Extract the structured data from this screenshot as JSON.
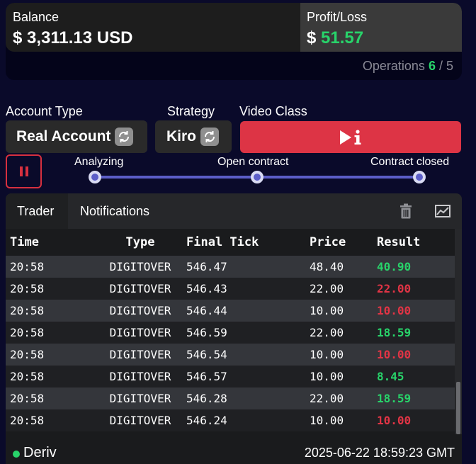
{
  "header": {
    "balance_label": "Balance",
    "balance_value": "$ 3,311.13 USD",
    "pl_label": "Profit/Loss",
    "pl_currency": "$",
    "pl_value": "51.57",
    "operations_label": "Operations",
    "operations_done": "6",
    "operations_sep": " / ",
    "operations_total": "5"
  },
  "controls": {
    "account_type_label": "Account Type",
    "account_type_value": "Real Account",
    "strategy_label": "Strategy",
    "strategy_value": "Kiro",
    "video_class_label": "Video Class"
  },
  "progress": {
    "steps": [
      "Analyzing",
      "Open contract",
      "Contract closed"
    ]
  },
  "tabs": [
    "Trader",
    "Notifications"
  ],
  "table": {
    "columns": [
      "Time",
      "Type",
      "Final Tick",
      "Price",
      "Result"
    ],
    "rows": [
      {
        "time": "20:58",
        "type": "DIGITOVER",
        "tick": "546.47",
        "price": "48.40",
        "result": "40.90",
        "status": "win"
      },
      {
        "time": "20:58",
        "type": "DIGITOVER",
        "tick": "546.43",
        "price": "22.00",
        "result": "22.00",
        "status": "loss"
      },
      {
        "time": "20:58",
        "type": "DIGITOVER",
        "tick": "546.44",
        "price": "10.00",
        "result": "10.00",
        "status": "loss"
      },
      {
        "time": "20:58",
        "type": "DIGITOVER",
        "tick": "546.59",
        "price": "22.00",
        "result": "18.59",
        "status": "win"
      },
      {
        "time": "20:58",
        "type": "DIGITOVER",
        "tick": "546.54",
        "price": "10.00",
        "result": "10.00",
        "status": "loss"
      },
      {
        "time": "20:58",
        "type": "DIGITOVER",
        "tick": "546.57",
        "price": "10.00",
        "result": "8.45",
        "status": "win"
      },
      {
        "time": "20:58",
        "type": "DIGITOVER",
        "tick": "546.28",
        "price": "22.00",
        "result": "18.59",
        "status": "win"
      },
      {
        "time": "20:58",
        "type": "DIGITOVER",
        "tick": "546.24",
        "price": "10.00",
        "result": "10.00",
        "status": "loss"
      }
    ]
  },
  "footer": {
    "broker": "Deriv",
    "timestamp": "2025-06-22 18:59:23 GMT"
  },
  "colors": {
    "win": "#28d36a",
    "loss": "#e03445",
    "accent_red": "#dd3445",
    "progress": "#5c5ec8"
  },
  "icons": [
    "refresh-icon",
    "play-info-icon",
    "pause-icon",
    "trash-icon",
    "chart-icon"
  ]
}
